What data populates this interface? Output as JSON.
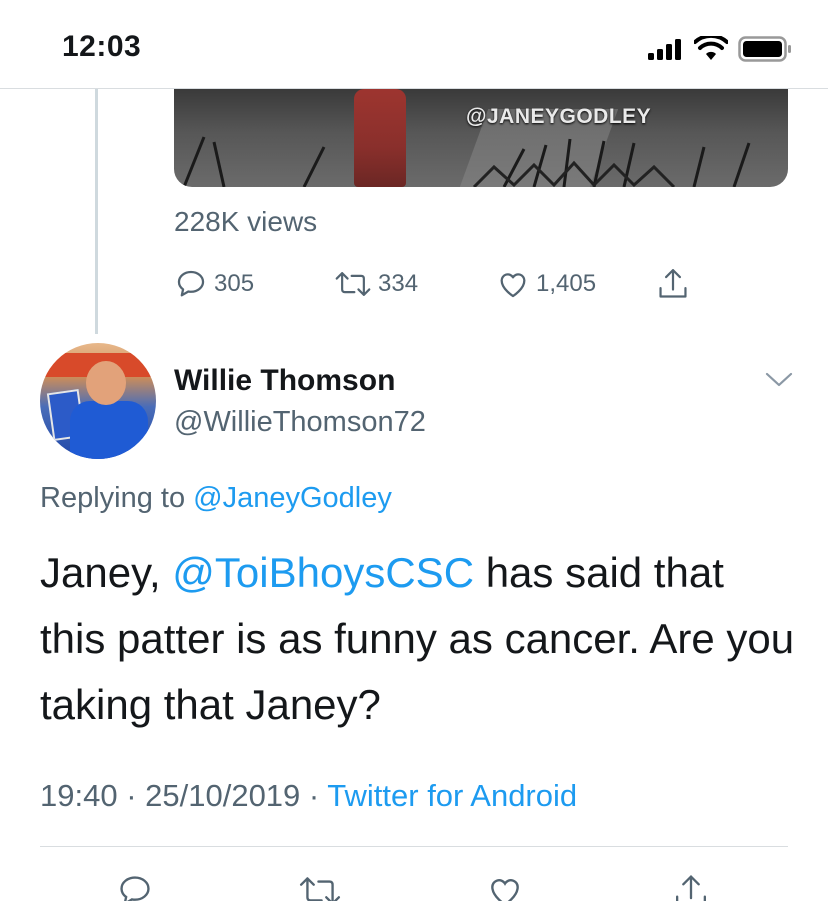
{
  "status_bar": {
    "time": "12:03",
    "icons": [
      "signal-icon",
      "wifi-icon",
      "battery-icon"
    ]
  },
  "media": {
    "watermark": "@JANEYGODLEY"
  },
  "tweet_stats": {
    "views": "228K views",
    "replies": "305",
    "retweets": "334",
    "likes": "1,405"
  },
  "reply": {
    "author_name": "Willie Thomson",
    "author_handle": "@WillieThomson72",
    "replying_prefix": "Replying to ",
    "replying_to": "@JaneyGodley",
    "text_part1": "Janey, ",
    "mention": "@ToiBhoysCSC",
    "text_part2": " has said that this patter is as funny as cancer. Are you taking that Janey?",
    "time": "19:40",
    "separator": " · ",
    "date": "25/10/2019",
    "source": "Twitter for Android"
  },
  "colors": {
    "link": "#1d9bf0",
    "secondary_text": "#536471",
    "primary_text": "#14171a"
  }
}
